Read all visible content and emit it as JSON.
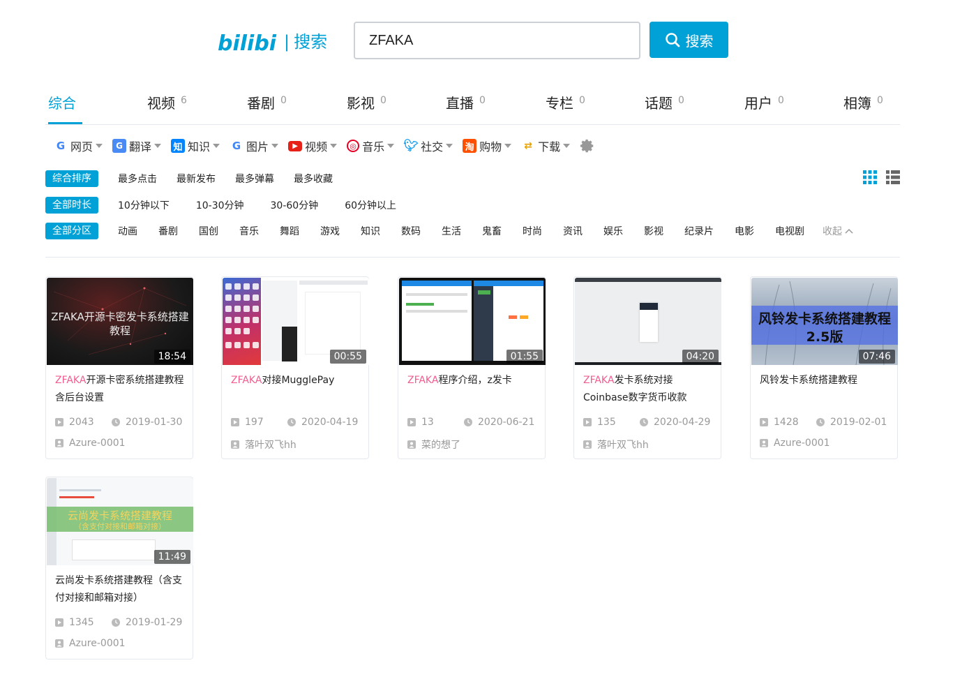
{
  "header": {
    "logo_text": "bilibili",
    "logo_sep": "|",
    "logo_label": "搜索",
    "search_value": "ZFAKA",
    "search_button": "搜索"
  },
  "tabs": [
    {
      "label": "综合",
      "count": ""
    },
    {
      "label": "视频",
      "count": "6"
    },
    {
      "label": "番剧",
      "count": "0"
    },
    {
      "label": "影视",
      "count": "0"
    },
    {
      "label": "直播",
      "count": "0"
    },
    {
      "label": "专栏",
      "count": "0"
    },
    {
      "label": "话题",
      "count": "0"
    },
    {
      "label": "用户",
      "count": "0"
    },
    {
      "label": "相簿",
      "count": "0"
    }
  ],
  "shortcuts": [
    {
      "label": "网页",
      "icon": "google-icon"
    },
    {
      "label": "翻译",
      "icon": "translate-icon"
    },
    {
      "label": "知识",
      "icon": "zhihu-icon"
    },
    {
      "label": "图片",
      "icon": "google-icon"
    },
    {
      "label": "视频",
      "icon": "youtube-icon"
    },
    {
      "label": "音乐",
      "icon": "netease-music-icon"
    },
    {
      "label": "社交",
      "icon": "twitter-icon"
    },
    {
      "label": "购物",
      "icon": "taobao-icon"
    },
    {
      "label": "下载",
      "icon": "download-icon"
    }
  ],
  "filters": {
    "sort": {
      "active": "综合排序",
      "items": [
        "最多点击",
        "最新发布",
        "最多弹幕",
        "最多收藏"
      ]
    },
    "duration": {
      "active": "全部时长",
      "items": [
        "10分钟以下",
        "10-30分钟",
        "30-60分钟",
        "60分钟以上"
      ]
    },
    "zone": {
      "active": "全部分区",
      "items": [
        "动画",
        "番剧",
        "国创",
        "音乐",
        "舞蹈",
        "游戏",
        "知识",
        "数码",
        "生活",
        "鬼畜",
        "时尚",
        "资讯",
        "娱乐",
        "影视",
        "纪录片",
        "电影",
        "电视剧"
      ],
      "collapse": "收起"
    }
  },
  "videos": [
    {
      "highlight": "ZFAKA",
      "title_rest": "开源卡密系统搭建教程含后台设置",
      "duration": "18:54",
      "plays": "2043",
      "date": "2019-01-30",
      "author": "Azure-0001",
      "thumb_text": "ZFAKA开源卡密发卡系统搭建教程"
    },
    {
      "highlight": "ZFAKA",
      "title_rest": "对接MugglePay",
      "duration": "00:55",
      "plays": "197",
      "date": "2020-04-19",
      "author": "落叶双飞hh",
      "thumb_text": ""
    },
    {
      "highlight": "ZFAKA",
      "title_rest": "程序介绍，z发卡",
      "duration": "01:55",
      "plays": "13",
      "date": "2020-06-21",
      "author": "菜的想了",
      "thumb_text": ""
    },
    {
      "highlight": "ZFAKA",
      "title_rest": "发卡系统对接Coinbase数字货币收款",
      "duration": "04:20",
      "plays": "135",
      "date": "2020-04-29",
      "author": "落叶双飞hh",
      "thumb_text": ""
    },
    {
      "highlight": "",
      "title_rest": "风铃发卡系统搭建教程",
      "duration": "07:46",
      "plays": "1428",
      "date": "2019-02-01",
      "author": "Azure-0001",
      "thumb_text": "风铃发卡系统搭建教程",
      "thumb_text2": "2.5版"
    },
    {
      "highlight": "",
      "title_rest": "云尚发卡系统搭建教程（含支付对接和邮箱对接）",
      "duration": "11:49",
      "plays": "1345",
      "date": "2019-01-29",
      "author": "Azure-0001",
      "thumb_text": "云尚发卡系统搭建教程",
      "thumb_text2": "（含支付对接和邮箱对接）"
    }
  ],
  "colors": {
    "accent": "#00a1d6",
    "highlight": "#f25d8e"
  }
}
